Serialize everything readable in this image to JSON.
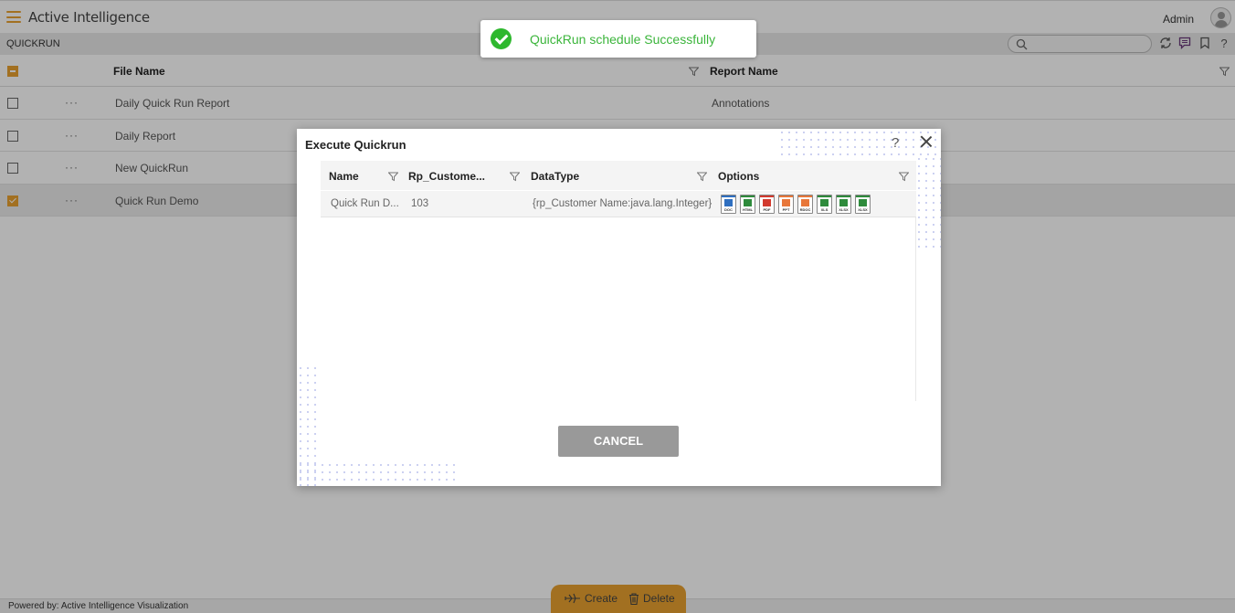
{
  "app": {
    "title": "Active Intelligence",
    "user": "Admin",
    "breadcrumb": "QUICKRUN",
    "accent_color": "#e8a130"
  },
  "toolbar": {
    "search_placeholder": "",
    "icons": [
      "refresh-icon",
      "comment-icon",
      "bookmark-icon",
      "help-icon"
    ]
  },
  "grid": {
    "columns": [
      "File Name",
      "Report Name"
    ],
    "rows": [
      {
        "file_name": "Daily Quick Run Report",
        "report_name": "Annotations",
        "checked": false
      },
      {
        "file_name": "Daily Report",
        "report_name": "",
        "checked": false
      },
      {
        "file_name": "New QuickRun",
        "report_name": "",
        "checked": false
      },
      {
        "file_name": "Quick Run Demo",
        "report_name": "",
        "checked": true
      }
    ],
    "row_menu": "···"
  },
  "toast": {
    "message": "QuickRun schedule Successfully",
    "status_color": "#2eb82e"
  },
  "modal": {
    "title": "Execute Quickrun",
    "help": "?",
    "columns": [
      "Name",
      "Rp_Custome...",
      "DataType",
      "Options"
    ],
    "rows": [
      {
        "name": "Quick Run D...",
        "rp_customer": "103",
        "datatype": "{rp_Customer Name:java.lang.Integer}"
      }
    ],
    "options": [
      {
        "label": "DOC",
        "icon": "doc-icon",
        "color": "#2f6fc0"
      },
      {
        "label": "HTML",
        "icon": "html-icon",
        "color": "#2e8b3c"
      },
      {
        "label": "PDF",
        "icon": "pdf-icon",
        "color": "#d23a2e"
      },
      {
        "label": "PPT",
        "icon": "ppt-icon",
        "color": "#e8773a"
      },
      {
        "label": "RDOC",
        "icon": "rdoc-icon",
        "color": "#e8773a"
      },
      {
        "label": "XLS",
        "icon": "xls-icon",
        "color": "#2e8b3c"
      },
      {
        "label": "XLSX",
        "icon": "xlsx-icon",
        "color": "#2e8b3c"
      },
      {
        "label": "XLSX",
        "icon": "xlsx-icon",
        "color": "#2e8b3c"
      }
    ],
    "cancel_label": "CANCEL"
  },
  "actions": {
    "create_label": "Create",
    "delete_label": "Delete"
  },
  "footer": {
    "text": "Powered by: Active Intelligence Visualization"
  }
}
